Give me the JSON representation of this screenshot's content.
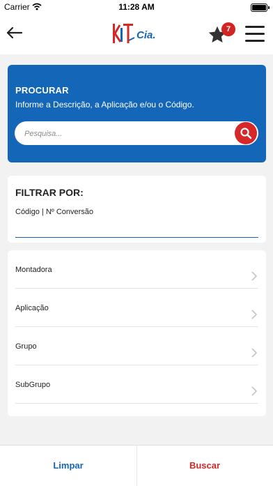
{
  "status_bar": {
    "carrier": "Carrier",
    "time": "11:28 AM"
  },
  "header": {
    "favorites_count": "7",
    "logo_letters": "KIT",
    "logo_text": "Cia."
  },
  "search": {
    "title": "PROCURAR",
    "subtitle": "Informe a Descrição, a Aplicação e/ou o Código.",
    "placeholder": "Pesquisa..."
  },
  "filter": {
    "title": "FILTRAR POR:",
    "field_label": "Código | Nº Conversão"
  },
  "list": {
    "items": [
      {
        "label": "Montadora"
      },
      {
        "label": "Aplicação"
      },
      {
        "label": "Grupo"
      },
      {
        "label": "SubGrupo"
      }
    ]
  },
  "footer": {
    "clear_label": "Limpar",
    "search_label": "Buscar"
  },
  "colors": {
    "primary_blue": "#1466b8",
    "accent_red": "#d62828",
    "background": "#f2f2f2"
  },
  "icons": [
    "wifi-icon",
    "battery-icon",
    "back-arrow-icon",
    "star-icon",
    "hamburger-menu-icon",
    "search-icon",
    "chevron-right-icon"
  ]
}
